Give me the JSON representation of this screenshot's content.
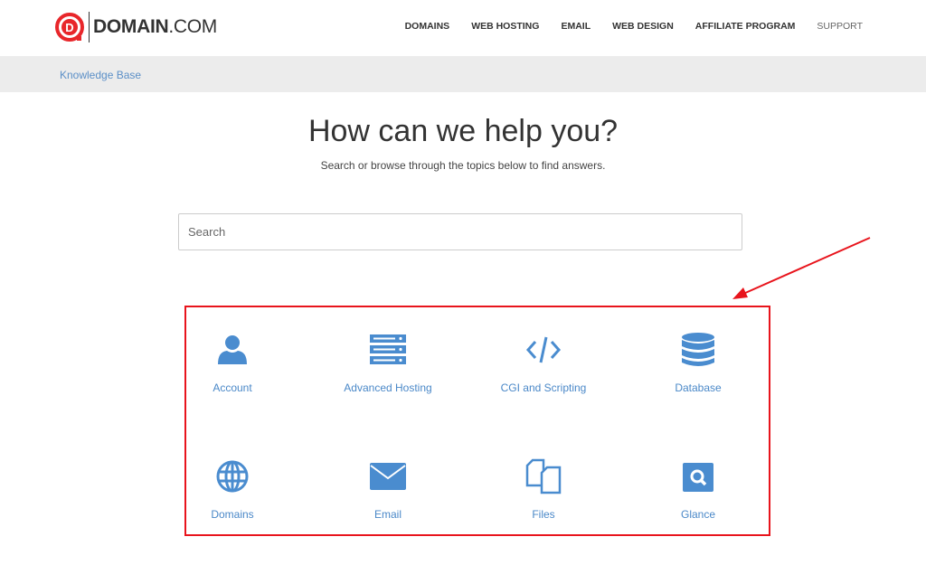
{
  "brand": {
    "name_bold": "DOMAIN",
    "name_rest": ".COM",
    "accent": "#e8262a"
  },
  "nav": [
    "DOMAINS",
    "WEB HOSTING",
    "EMAIL",
    "WEB DESIGN",
    "AFFILIATE PROGRAM",
    "SUPPORT"
  ],
  "breadcrumb": "Knowledge Base",
  "hero": {
    "title": "How can we help you?",
    "subtitle": "Search or browse through the topics below to find answers."
  },
  "search": {
    "placeholder": "Search",
    "value": ""
  },
  "topics": [
    {
      "label": "Account",
      "icon": "user-icon"
    },
    {
      "label": "Advanced Hosting",
      "icon": "server-icon"
    },
    {
      "label": "CGI and Scripting",
      "icon": "code-icon"
    },
    {
      "label": "Database",
      "icon": "database-icon"
    },
    {
      "label": "Domains",
      "icon": "globe-icon"
    },
    {
      "label": "Email",
      "icon": "envelope-icon"
    },
    {
      "label": "Files",
      "icon": "files-icon"
    },
    {
      "label": "Glance",
      "icon": "search-square-icon"
    }
  ],
  "colors": {
    "icon": "#4a8ccf",
    "highlight": "#e8141c"
  }
}
